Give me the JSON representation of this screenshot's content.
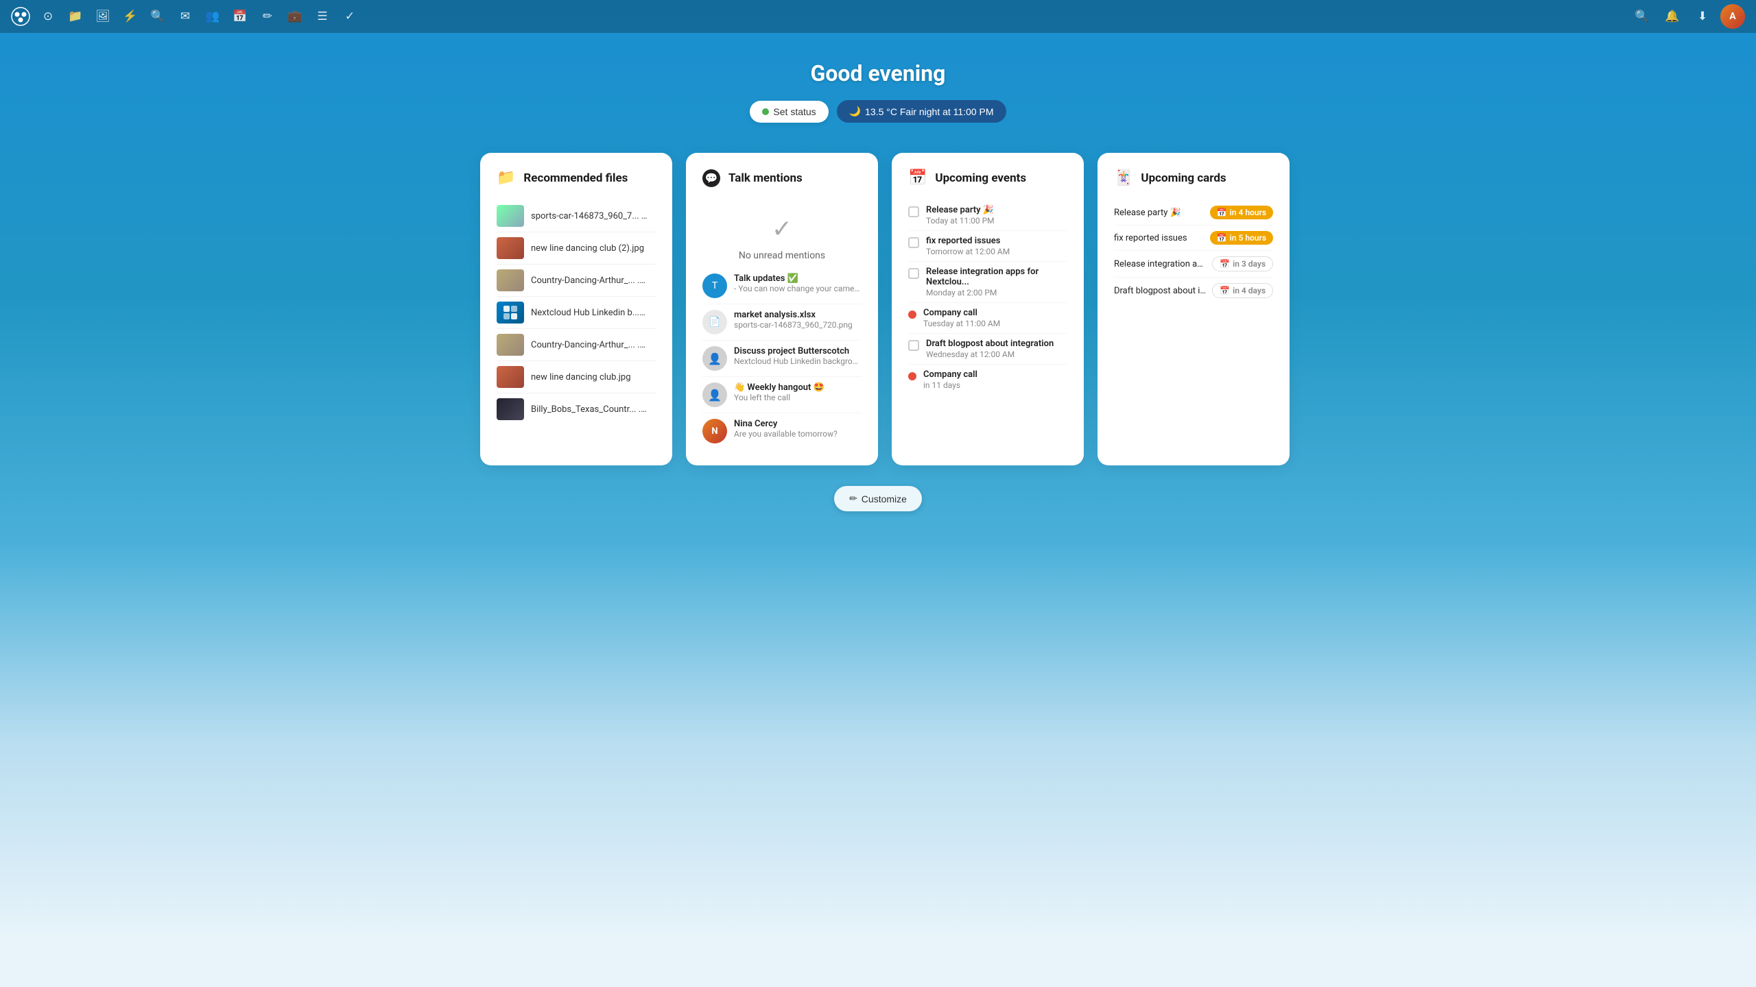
{
  "topbar": {
    "nav_items": [
      {
        "icon": "⊙",
        "label": "home",
        "name": "home-icon"
      },
      {
        "icon": "📁",
        "label": "files",
        "name": "files-icon"
      },
      {
        "icon": "🖼",
        "label": "photos",
        "name": "photos-icon"
      },
      {
        "icon": "⚡",
        "label": "activity",
        "name": "activity-icon"
      },
      {
        "icon": "🔍",
        "label": "search",
        "name": "search-icon"
      },
      {
        "icon": "✉",
        "label": "mail",
        "name": "mail-icon"
      },
      {
        "icon": "👥",
        "label": "contacts",
        "name": "contacts-icon"
      },
      {
        "icon": "📅",
        "label": "calendar",
        "name": "calendar-icon"
      },
      {
        "icon": "✏",
        "label": "notes",
        "name": "notes-icon"
      },
      {
        "icon": "💼",
        "label": "deck",
        "name": "deck-icon"
      },
      {
        "icon": "☰",
        "label": "more",
        "name": "more-icon"
      },
      {
        "icon": "✓",
        "label": "tasks",
        "name": "tasks-icon"
      }
    ],
    "search_label": "Search",
    "notifications_label": "Notifications",
    "downloads_label": "Downloads",
    "avatar_initials": "A"
  },
  "greeting": {
    "title": "Good evening",
    "set_status_label": "Set status",
    "weather_label": "13.5 °C Fair night at 11:00 PM",
    "weather_icon": "🌙"
  },
  "recommended_files": {
    "title": "Recommended files",
    "items": [
      {
        "name": "sports-car-146873_960_7...  .png",
        "color": "#8899aa"
      },
      {
        "name": "new line dancing club (2).jpg",
        "color": "#cc6633"
      },
      {
        "name": "Country-Dancing-Arthur_... .jpg",
        "color": "#aa8844"
      },
      {
        "name": "Nextcloud Hub Linkedin b...  .png",
        "color": "#0082c9"
      },
      {
        "name": "Country-Dancing-Arthur_... .jpg",
        "color": "#aa8844"
      },
      {
        "name": "new line dancing club.jpg",
        "color": "#cc6633"
      },
      {
        "name": "Billy_Bobs_Texas_Countr...  .jpg",
        "color": "#223355"
      }
    ]
  },
  "talk_mentions": {
    "title": "Talk mentions",
    "no_mentions_text": "No unread mentions",
    "items": [
      {
        "name": "Talk updates ✅",
        "text": "- You can now change your camer...",
        "avatar_type": "blue",
        "avatar_text": "T"
      },
      {
        "name": "market analysis.xlsx",
        "text": "sports-car-146873_960_720.png",
        "avatar_type": "gray",
        "avatar_text": "📄"
      },
      {
        "name": "Discuss project Butterscotch",
        "text": "Nextcloud Hub Linkedin backgrou...",
        "avatar_type": "gray",
        "avatar_text": "👤"
      },
      {
        "name": "👋 Weekly hangout 🤩",
        "text": "You left the call",
        "avatar_type": "gray",
        "avatar_text": "👤"
      },
      {
        "name": "Nina Cercy",
        "text": "Are you available tomorrow?",
        "avatar_type": "photo",
        "avatar_text": "N"
      }
    ]
  },
  "upcoming_events": {
    "title": "Upcoming events",
    "items": [
      {
        "title": "Release party 🎉",
        "time": "Today at 11:00 PM",
        "type": "checkbox"
      },
      {
        "title": "fix reported issues",
        "time": "Tomorrow at 12:00 AM",
        "type": "checkbox"
      },
      {
        "title": "Release integration apps for Nextclou...",
        "time": "Monday at 2:00 PM",
        "type": "checkbox"
      },
      {
        "title": "Company call",
        "time": "Tuesday at 11:00 AM",
        "type": "dot",
        "dot_color": "red"
      },
      {
        "title": "Draft blogpost about integration",
        "time": "Wednesday at 12:00 AM",
        "type": "checkbox"
      },
      {
        "title": "Company call",
        "time": "in 11 days",
        "type": "dot",
        "dot_color": "red"
      }
    ]
  },
  "upcoming_cards": {
    "title": "Upcoming cards",
    "items": [
      {
        "name": "Release party 🎉",
        "badge": "in 4 hours",
        "badge_type": "yellow"
      },
      {
        "name": "fix reported issues",
        "badge": "in 5 hours",
        "badge_type": "yellow"
      },
      {
        "name": "Release integration apps for...",
        "badge": "in 3 days",
        "badge_type": "gray"
      },
      {
        "name": "Draft blogpost about integra...",
        "badge": "in 4 days",
        "badge_type": "gray"
      }
    ]
  },
  "customize": {
    "label": "Customize"
  },
  "colors": {
    "accent": "#1a8fd1",
    "badge_yellow": "#f0a500"
  }
}
